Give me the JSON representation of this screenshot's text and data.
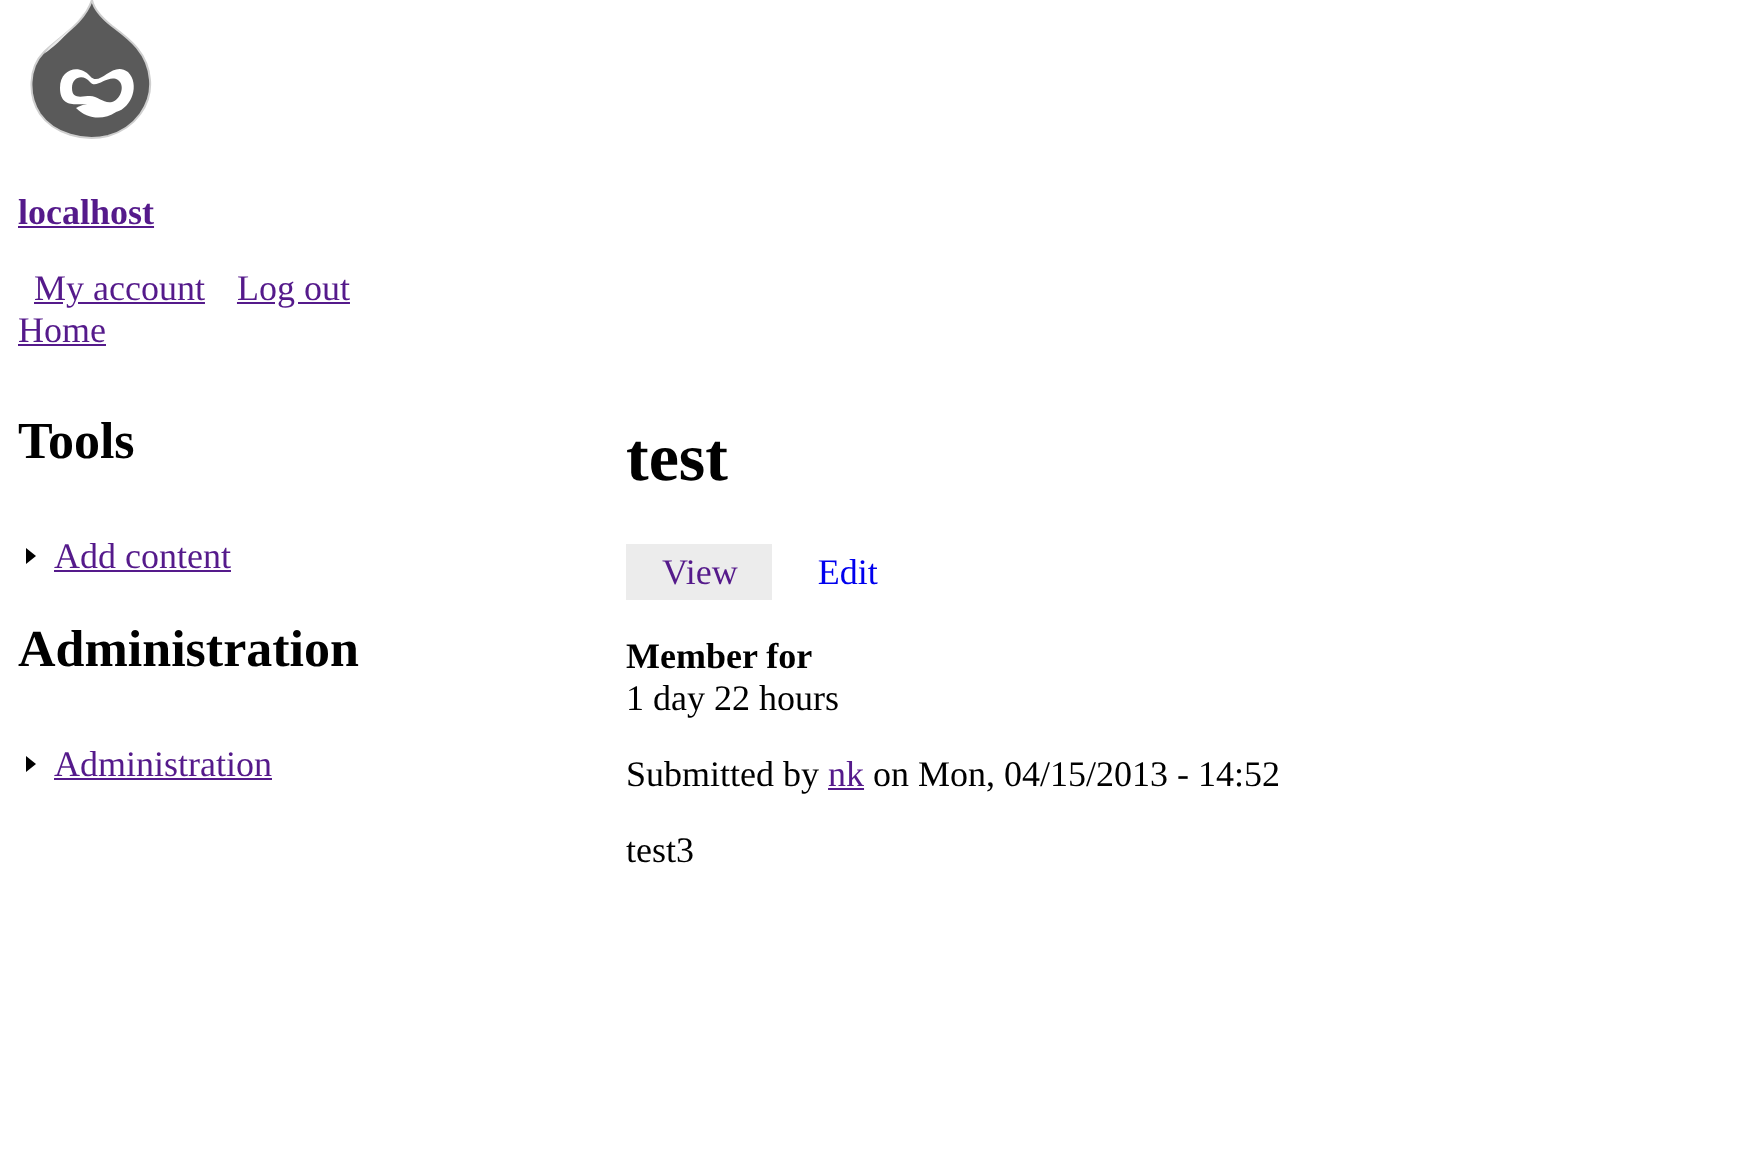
{
  "site": {
    "name": "localhost"
  },
  "user_menu": [
    {
      "label": "My account"
    },
    {
      "label": "Log out"
    }
  ],
  "main_menu": [
    {
      "label": "Home"
    }
  ],
  "sidebar": [
    {
      "title": "Tools",
      "items": [
        {
          "label": "Add content"
        }
      ]
    },
    {
      "title": "Administration",
      "items": [
        {
          "label": "Administration"
        }
      ]
    }
  ],
  "page": {
    "title": "test",
    "tabs": [
      {
        "label": "View",
        "selected": true
      },
      {
        "label": "Edit",
        "selected": false
      }
    ],
    "member_for": {
      "label": "Member for",
      "value": "1 day 22 hours"
    },
    "submitted": {
      "prefix": "Submitted by",
      "author": "nk",
      "suffix": "on Mon, 04/15/2013 - 14:52"
    },
    "body": "test3"
  }
}
